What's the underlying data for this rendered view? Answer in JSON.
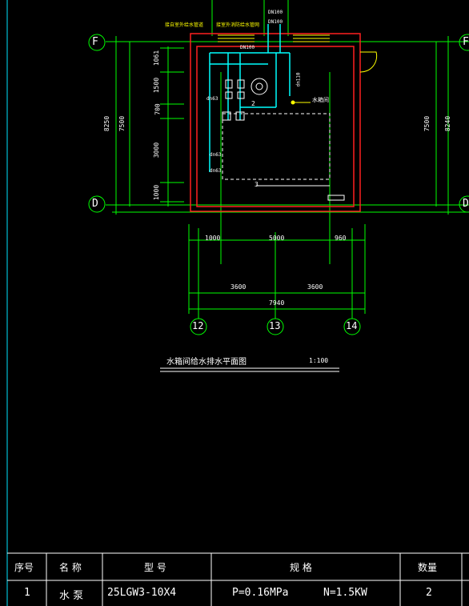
{
  "grid_labels": {
    "F_left": "F",
    "F_right": "F",
    "D_left": "D",
    "D_right": "D",
    "c12": "12",
    "c13": "13",
    "c14": "14"
  },
  "dims": {
    "left_1": "1061",
    "left_2": "1500",
    "left_3": "700",
    "left_4": "3000",
    "left_5": "1000",
    "left_total_a": "7500",
    "left_total_b": "8250",
    "right_a": "7500",
    "right_b": "8240",
    "bottom_1": "1000",
    "bottom_2": "5000",
    "bottom_3": "960",
    "bottom_4": "3600",
    "bottom_5": "3600",
    "bottom_total": "7940"
  },
  "annotations": {
    "pipe_top_1": "DN100",
    "pipe_top_2": "DN100",
    "pipe_mid": "DN100",
    "label_tl_1": "接自室外给水管道",
    "label_tl_2": "接室外消防给水管网",
    "dn_right": "dn110",
    "dn_left": "dn63",
    "dn_left2": "dn63",
    "dn_left3": "dn63",
    "tank_label": "水箱间",
    "mark_2": "2",
    "mark_3": "3"
  },
  "drawing": {
    "title": "水箱间给水排水平面图",
    "scale": "1:100"
  },
  "table": {
    "headers": {
      "seq": "序号",
      "name": "名 称",
      "model": "型 号",
      "spec": "规 格",
      "qty": "数量"
    },
    "row1": {
      "seq": "1",
      "name": "水 泵",
      "model": "25LGW3-10X4",
      "spec_p": "P=0.16MPa",
      "spec_n": "N=1.5KW",
      "qty": "2"
    }
  },
  "colors": {
    "frame": "#00e5ff",
    "grid": "#00ff00",
    "wall": "#ff2020",
    "pipe": "#00ffff",
    "hatch": "#ffff00",
    "text": "#ffffff"
  }
}
